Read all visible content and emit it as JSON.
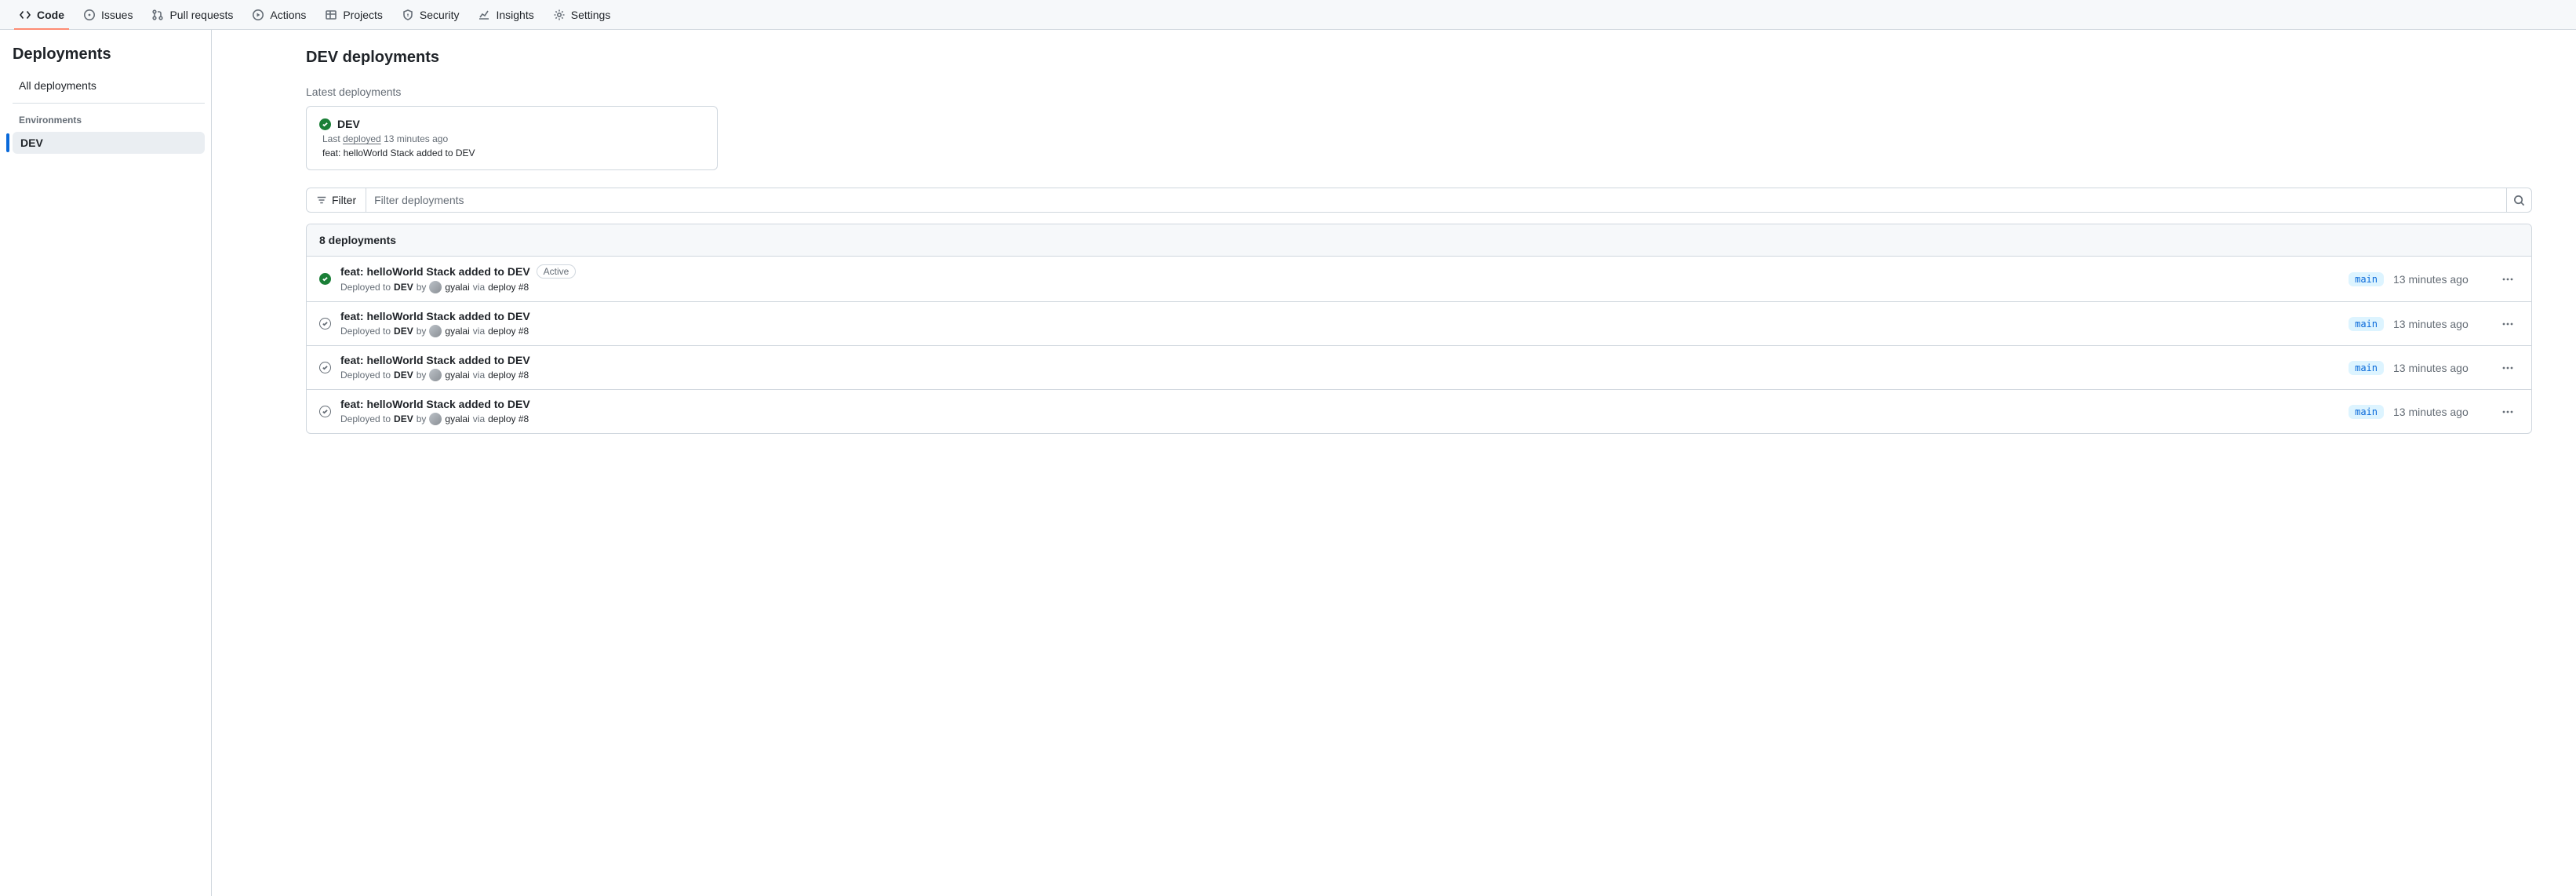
{
  "topnav": [
    {
      "label": "Code",
      "icon": "code",
      "selected": true
    },
    {
      "label": "Issues",
      "icon": "issue",
      "selected": false
    },
    {
      "label": "Pull requests",
      "icon": "pr",
      "selected": false
    },
    {
      "label": "Actions",
      "icon": "play",
      "selected": false
    },
    {
      "label": "Projects",
      "icon": "table",
      "selected": false
    },
    {
      "label": "Security",
      "icon": "shield",
      "selected": false
    },
    {
      "label": "Insights",
      "icon": "graph",
      "selected": false
    },
    {
      "label": "Settings",
      "icon": "gear",
      "selected": false
    }
  ],
  "sidebar": {
    "title": "Deployments",
    "all_link": "All deployments",
    "env_heading": "Environments",
    "env_selected": "DEV"
  },
  "page": {
    "title": "DEV deployments",
    "latest_label": "Latest deployments"
  },
  "latest_card": {
    "env": "DEV",
    "last_prefix": "Last ",
    "deployed_word": "deployed",
    "last_suffix": " 13 minutes ago",
    "message": "feat: helloWorld Stack added to DEV"
  },
  "filter": {
    "button": "Filter",
    "placeholder": "Filter deployments"
  },
  "list": {
    "count_label": "8 deployments",
    "rows": [
      {
        "status": "success",
        "title": "feat: helloWorld Stack added to DEV",
        "active": true,
        "deployed_to": "Deployed to",
        "env": "DEV",
        "by": "by",
        "user": "gyalai",
        "via": "via",
        "run": "deploy #8",
        "branch": "main",
        "time": "13 minutes ago"
      },
      {
        "status": "neutral",
        "title": "feat: helloWorld Stack added to DEV",
        "active": false,
        "deployed_to": "Deployed to",
        "env": "DEV",
        "by": "by",
        "user": "gyalai",
        "via": "via",
        "run": "deploy #8",
        "branch": "main",
        "time": "13 minutes ago"
      },
      {
        "status": "neutral",
        "title": "feat: helloWorld Stack added to DEV",
        "active": false,
        "deployed_to": "Deployed to",
        "env": "DEV",
        "by": "by",
        "user": "gyalai",
        "via": "via",
        "run": "deploy #8",
        "branch": "main",
        "time": "13 minutes ago"
      },
      {
        "status": "neutral",
        "title": "feat: helloWorld Stack added to DEV",
        "active": false,
        "deployed_to": "Deployed to",
        "env": "DEV",
        "by": "by",
        "user": "gyalai",
        "via": "via",
        "run": "deploy #8",
        "branch": "main",
        "time": "13 minutes ago"
      }
    ],
    "active_badge": "Active"
  }
}
